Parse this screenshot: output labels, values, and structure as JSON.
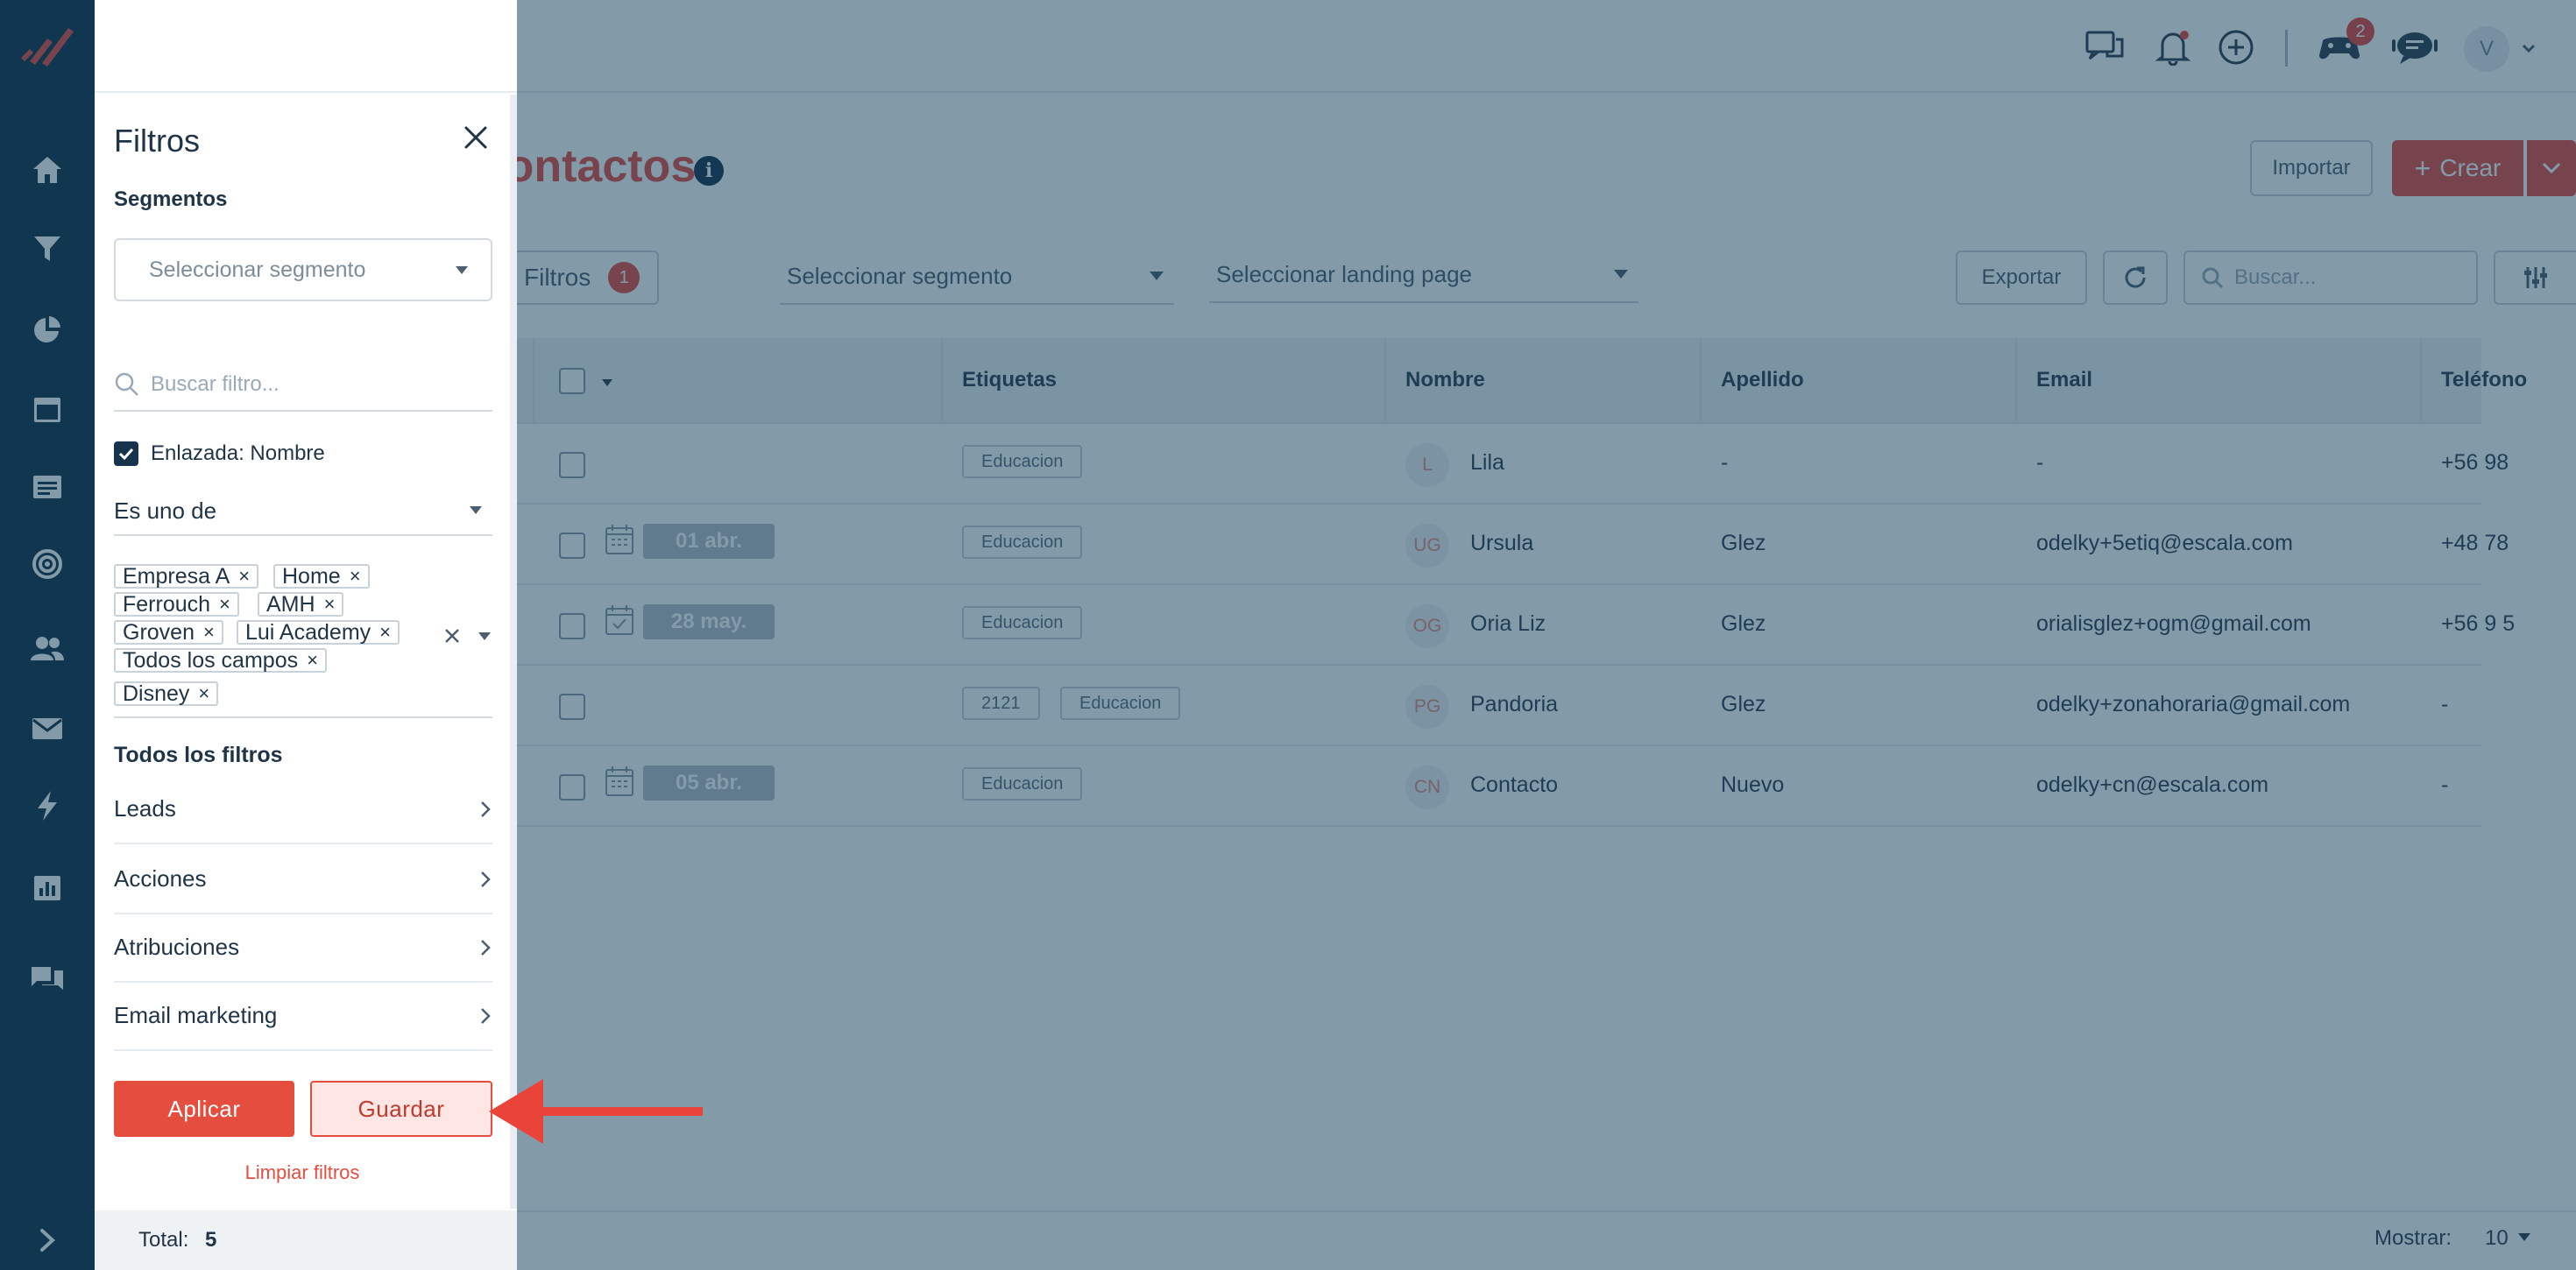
{
  "nav": {
    "icons": [
      "home-icon",
      "funnel-icon",
      "pie-chart-icon",
      "browser-window-icon",
      "form-icon",
      "target-icon",
      "people-icon",
      "mail-icon",
      "bolt-icon",
      "report-icon",
      "chat-icon"
    ]
  },
  "topbar": {
    "notifications_badge": "2",
    "avatar_initial": "V"
  },
  "page": {
    "title": "Contactos",
    "info": "i",
    "import_label": "Importar",
    "create_label": "Crear",
    "filters_label": "Filtros",
    "filters_count": "1",
    "segment_placeholder": "Seleccionar segmento",
    "landing_placeholder": "Seleccionar landing page",
    "export_label": "Exportar",
    "search_placeholder": "Buscar..."
  },
  "table": {
    "columns": [
      "Etiquetas",
      "Nombre",
      "Apellido",
      "Email",
      "Teléfono"
    ],
    "rows": [
      {
        "date": "",
        "tags": [
          "Educacion"
        ],
        "initials": "L",
        "name": "Lila",
        "lastname": "-",
        "email": "-",
        "phone": "+56 98"
      },
      {
        "date": "01 abr.",
        "tags": [
          "Educacion"
        ],
        "initials": "UG",
        "name": "Ursula",
        "lastname": "Glez",
        "email": "odelky+5etiq@escala.com",
        "phone": "+48 78"
      },
      {
        "date": "28 may.",
        "tags": [
          "Educacion"
        ],
        "initials": "OG",
        "name": "Oria Liz",
        "lastname": "Glez",
        "email": "orialisglez+ogm@gmail.com",
        "phone": "+56 9 5"
      },
      {
        "date": "",
        "tags": [
          "2121",
          "Educacion"
        ],
        "initials": "PG",
        "name": "Pandoria",
        "lastname": "Glez",
        "email": "odelky+zonahoraria@gmail.com",
        "phone": "-"
      },
      {
        "date": "05 abr.",
        "tags": [
          "Educacion"
        ],
        "initials": "CN",
        "name": "Contacto",
        "lastname": "Nuevo",
        "email": "odelky+cn@escala.com",
        "phone": "-"
      }
    ]
  },
  "footer": {
    "total_label": "Total:",
    "total_value": "5",
    "show_label": "Mostrar:",
    "show_value": "10"
  },
  "panel": {
    "title": "Filtros",
    "segments_label": "Segmentos",
    "segment_placeholder": "Seleccionar segmento",
    "search_placeholder": "Buscar filtro...",
    "linked_label": "Enlazada: Nombre",
    "operator": "Es uno de",
    "values": [
      "Empresa A",
      "Home",
      "Ferrouch",
      "AMH",
      "Groven",
      "Lui Academy",
      "Todos los campos",
      "Disney"
    ],
    "all_filters_label": "Todos los filtros",
    "categories": [
      "Leads",
      "Acciones",
      "Atribuciones",
      "Email marketing"
    ],
    "apply_label": "Aplicar",
    "save_label": "Guardar",
    "clear_label": "Limpiar filtros"
  },
  "colors": {
    "brand": "#e54d3f",
    "nav": "#0f2f45",
    "overlay": "#123e5a"
  }
}
